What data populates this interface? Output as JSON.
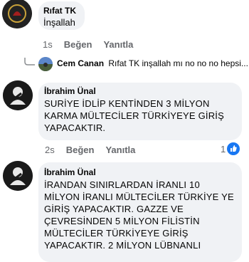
{
  "comments": [
    {
      "author": "Rıfat TK",
      "text": "İnşallah",
      "time": "1s",
      "like_label": "Beğen",
      "reply_label": "Yanıtla"
    },
    {
      "author": "İbrahim Ünal",
      "text_lines": [
        "SURİYE İDLİP KENTİNDEN 3 MİLYON",
        "KARMA MÜLTECİLER TÜRKİYEYE GİRİŞ",
        "YAPACAKTIR."
      ],
      "time": "2s",
      "like_label": "Beğen",
      "reply_label": "Yanıtla",
      "reaction_count": "1"
    },
    {
      "author": "İbrahim Ünal",
      "text_lines": [
        "İRANDAN SINIRLARDAN İRANLI 10",
        "MİLYON İRANLI MÜLTECİLER TÜRKİYE YE",
        "GİRİŞ YAPACAKTIR. GAZZE VE",
        "ÇEVRESİNDEN 5 MİLYON FİLİSTİN",
        "MÜLTECİLER TÜRKİYEYE GİRİŞ",
        "YAPACAKTIR. 2 MİLYON LÜBNANLI"
      ]
    }
  ],
  "reply_preview": {
    "author": "Cem Canan",
    "text": "Rıfat TK inşallah mı no no no hepsi..."
  },
  "colors": {
    "bubble": "#f0f2f5",
    "meta": "#65676b",
    "like_icon": "#1877f2"
  },
  "icons": [
    "reply-arrow-icon",
    "like-thumb-icon"
  ]
}
